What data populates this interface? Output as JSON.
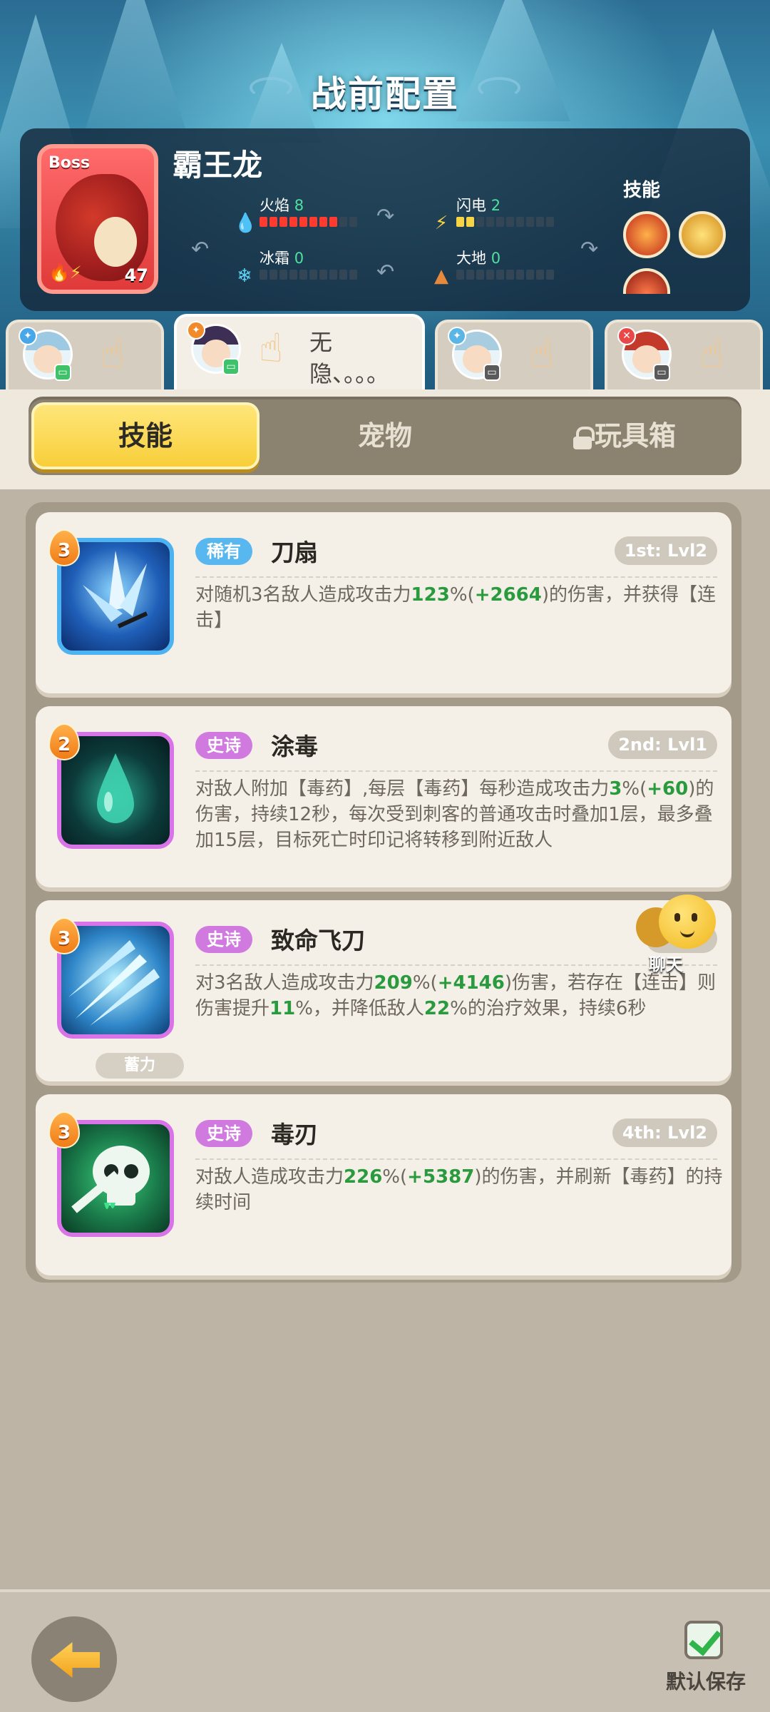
{
  "header": {
    "title": "战前配置"
  },
  "boss": {
    "tag": "Boss",
    "name": "霸王龙",
    "level": "47",
    "stats": {
      "fire": {
        "label": "火焰",
        "value": "8",
        "max": 10
      },
      "lightning": {
        "label": "闪电",
        "value": "2",
        "max": 10
      },
      "ice": {
        "label": "冰霜",
        "value": "0",
        "max": 10
      },
      "earth": {
        "label": "大地",
        "value": "0",
        "max": 10
      }
    },
    "skills_label": "技能",
    "colors": {
      "fire": "#ff3b30",
      "lightning": "#f7d443",
      "ice": "#5fd3f3",
      "earth": "#e58a3c"
    }
  },
  "heroes": [
    {
      "name": "",
      "element_icon": "ice-icon",
      "status": "green"
    },
    {
      "name": "无隐、。。。",
      "element_icon": "fire-icon",
      "status": "green",
      "active": true
    },
    {
      "name": "",
      "element_icon": "water-icon",
      "status": "gray"
    },
    {
      "name": "",
      "element_icon": "blade-icon",
      "status": "gray"
    }
  ],
  "categories": {
    "skills": "技能",
    "pets": "宠物",
    "toybox": "玩具箱"
  },
  "skills": [
    {
      "rarity": "稀有",
      "name": "刀扇",
      "slot": "1st: Lvl2",
      "level": "3",
      "desc_pre": "对随机3名敌人造成攻击力",
      "val1": "123",
      "unit1": "%(",
      "val2": "+2664",
      "desc_post": ")的伤害，并获得【连击】"
    },
    {
      "rarity": "史诗",
      "name": "涂毒",
      "slot": "2nd: Lvl1",
      "level": "2",
      "desc_pre": "对敌人附加【毒药】,每层【毒药】每秒造成攻击力",
      "val1": "3",
      "unit1": "%(",
      "val2": "+60",
      "desc_post": ")的伤害，持续12秒，每次受到刺客的普通攻击时叠加1层，最多叠加15层，目标死亡时印记将转移到附近敌人"
    },
    {
      "rarity": "史诗",
      "name": "致命飞刀",
      "slot": "",
      "level": "3",
      "charge": "蓄力",
      "desc_pre": "对3名敌人造成攻击力",
      "val1": "209",
      "unit1": "%(",
      "val2": "+4146",
      "desc_mid": ")伤害，若存在【连击】则伤害提升",
      "val3": "11",
      "desc_mid2": "%，并降低敌人",
      "val4": "22",
      "desc_post": "%的治疗效果，持续6秒"
    },
    {
      "rarity": "史诗",
      "name": "毒刃",
      "slot": "4th: Lvl2",
      "level": "3",
      "desc_pre": "对敌人造成攻击力",
      "val1": "226",
      "unit1": "%(",
      "val2": "+5387",
      "desc_post": ")的伤害，并刷新【毒药】的持续时间"
    }
  ],
  "chat": {
    "label": "聊天"
  },
  "footer": {
    "save_label": "默认保存"
  }
}
